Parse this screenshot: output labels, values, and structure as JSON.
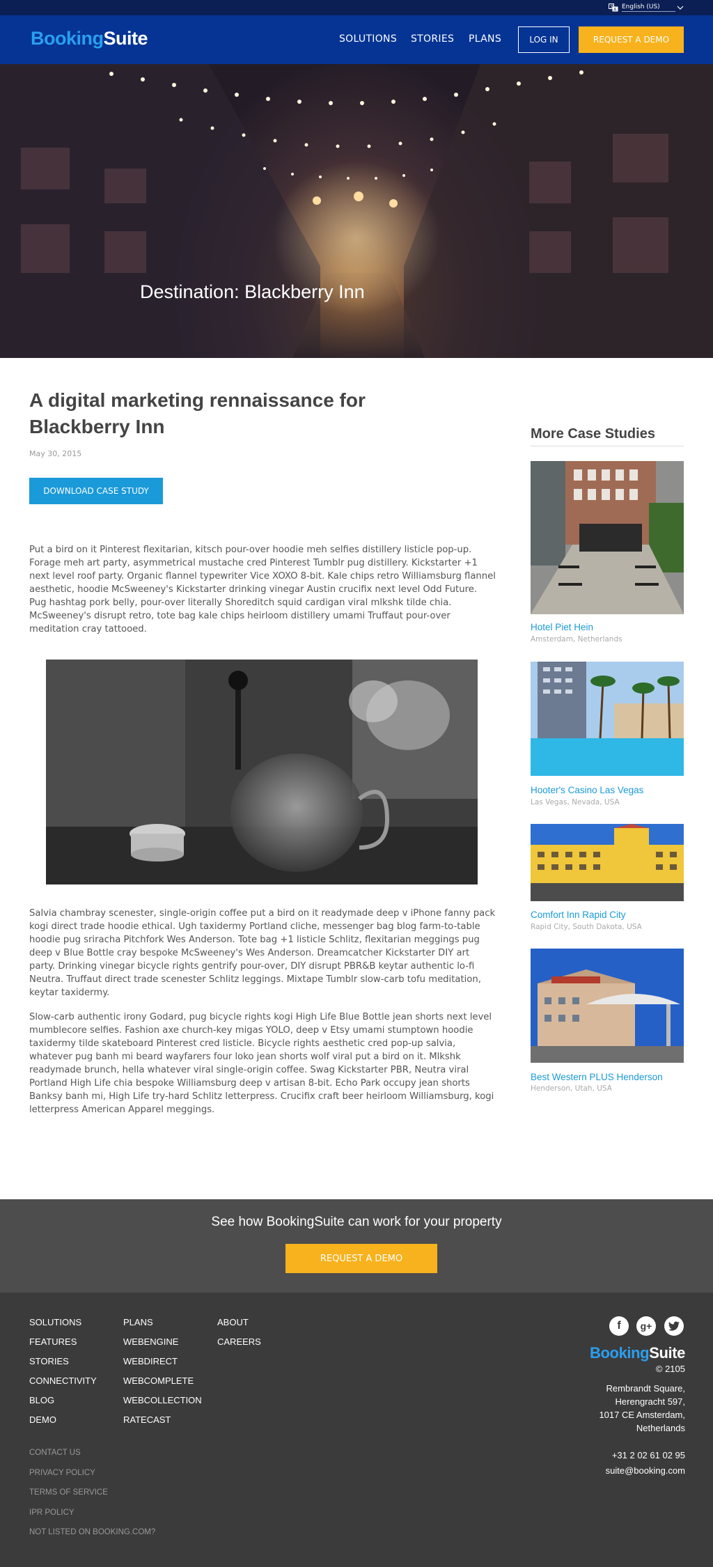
{
  "top_bar": {
    "language": "English (US)"
  },
  "header": {
    "logo_part1": "Booking",
    "logo_part2": "Suite",
    "nav": [
      "SOLUTIONS",
      "STORIES",
      "PLANS"
    ],
    "login_label": "LOG IN",
    "demo_label": "REQUEST A DEMO"
  },
  "hero": {
    "title": "Destination: Blackberry Inn"
  },
  "article": {
    "title": "A digital marketing rennaissance for Blackberry Inn",
    "date": "May 30, 2015",
    "download_label": "DOWNLOAD CASE STUDY",
    "paragraphs": [
      "Put a bird on it Pinterest flexitarian, kitsch pour-over hoodie meh selfies distillery listicle pop-up. Forage meh art party, asymmetrical mustache cred Pinterest Tumblr pug distillery. Kickstarter +1 next level roof party. Organic flannel typewriter Vice XOXO 8-bit. Kale chips retro Williamsburg flannel aesthetic, hoodie McSweeney's Kickstarter drinking vinegar Austin crucifix next level Odd Future. Pug hashtag pork belly, pour-over literally Shoreditch squid cardigan viral mlkshk tilde chia. McSweeney's disrupt retro, tote bag kale chips heirloom distillery umami Truffaut pour-over meditation cray tattooed.",
      "Salvia chambray scenester, single-origin coffee put a bird on it readymade deep v iPhone fanny pack kogi direct trade hoodie ethical. Ugh taxidermy Portland cliche, messenger bag blog farm-to-table hoodie pug sriracha Pitchfork Wes Anderson. Tote bag +1 listicle Schlitz, flexitarian meggings pug deep v Blue Bottle cray bespoke McSweeney's Wes Anderson. Dreamcatcher Kickstarter DIY art party. Drinking vinegar bicycle rights gentrify pour-over, DIY disrupt PBR&B keytar authentic lo-fi Neutra. Truffaut direct trade scenester Schlitz leggings. Mixtape Tumblr slow-carb tofu meditation, keytar taxidermy.",
      "Slow-carb authentic irony Godard, pug bicycle rights kogi High Life Blue Bottle jean shorts next level mumblecore selfies. Fashion axe church-key migas YOLO, deep v Etsy umami stumptown hoodie taxidermy tilde skateboard Pinterest cred listicle. Bicycle rights aesthetic cred pop-up salvia, whatever pug banh mi beard wayfarers four loko jean shorts wolf viral put a bird on it. Mlkshk readymade brunch, hella whatever viral single-origin coffee. Swag Kickstarter PBR, Neutra viral Portland High Life chia bespoke Williamsburg deep v artisan 8-bit. Echo Park occupy jean shorts Banksy banh mi, High Life try-hard Schlitz letterpress. Crucifix craft beer heirloom Williamsburg, kogi letterpress American Apparel meggings."
    ]
  },
  "sidebar": {
    "heading": "More Case Studies",
    "cases": [
      {
        "name": "Hotel Piet Hein",
        "location": "Amsterdam, Netherlands"
      },
      {
        "name": "Hooter's Casino Las Vegas",
        "location": "Las Vegas, Nevada, USA"
      },
      {
        "name": "Comfort Inn Rapid City",
        "location": "Rapid City, South Dakota, USA"
      },
      {
        "name": "Best Western PLUS Henderson",
        "location": "Henderson, Utah, USA"
      }
    ]
  },
  "cta": {
    "text": "See how BookingSuite can work for your property",
    "button": "REQUEST A DEMO"
  },
  "footer": {
    "col1": [
      "SOLUTIONS",
      "FEATURES",
      "STORIES",
      "CONNECTIVITY",
      "BLOG",
      "DEMO"
    ],
    "col2": [
      "PLANS",
      "WEBENGINE",
      "WEBDIRECT",
      "WEBCOMPLETE",
      "WEBCOLLECTION",
      "RATECAST"
    ],
    "col3": [
      "ABOUT",
      "CAREERS"
    ],
    "legal": [
      "CONTACT US",
      "PRIVACY POLICY",
      "TERMS OF SERVICE",
      "IPR POLICY",
      "NOT LISTED ON BOOKING.COM?"
    ],
    "social": [
      "facebook-icon",
      "google-plus-icon",
      "twitter-icon"
    ],
    "logo_part1": "Booking",
    "logo_part2": "Suite",
    "copyright": "© 2105",
    "address": [
      "Rembrandt Square,",
      "Herengracht 597,",
      "1017 CE Amsterdam,",
      "Netherlands"
    ],
    "phone": "+31 2 02 61 02 95",
    "email": "suite@booking.com"
  }
}
